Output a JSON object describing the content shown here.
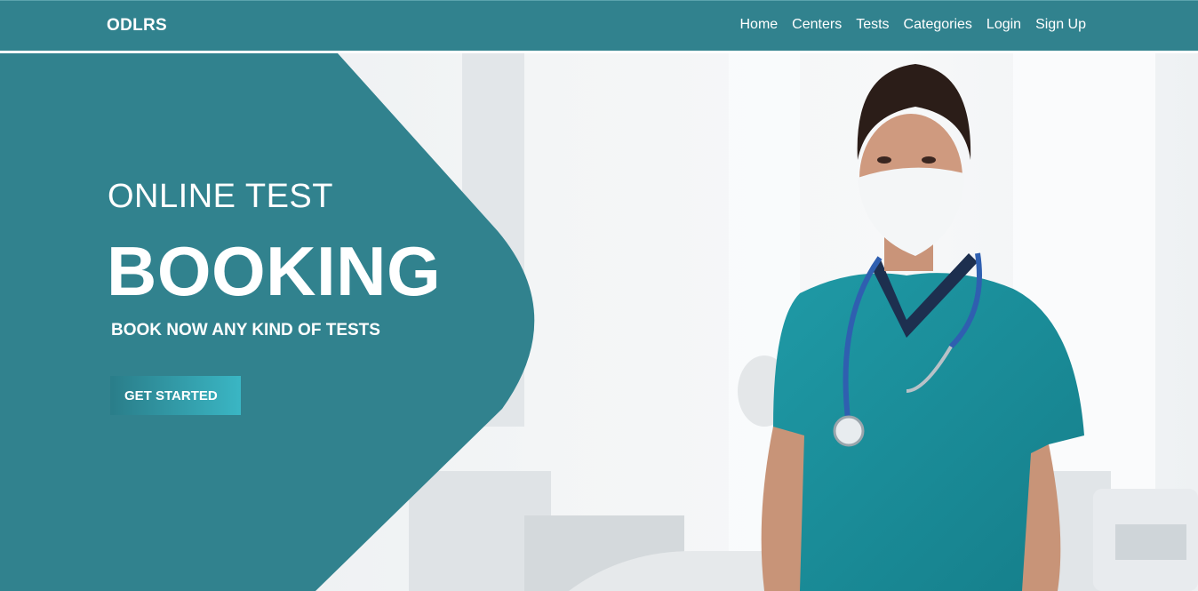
{
  "navbar": {
    "brand": "ODLRS",
    "links": [
      "Home",
      "Centers",
      "Tests",
      "Categories",
      "Login",
      "Sign Up"
    ]
  },
  "hero": {
    "title_line_1": "ONLINE TEST",
    "title_line_2": "BOOKING",
    "subtitle": "BOOK NOW ANY KIND OF TESTS",
    "cta_label": "GET STARTED",
    "image": "nurse-in-clinic-photo"
  },
  "colors": {
    "primary": "#31828e",
    "cta_gradient_start": "#2a7d89",
    "cta_gradient_end": "#3ab6c4",
    "text": "#ffffff"
  }
}
